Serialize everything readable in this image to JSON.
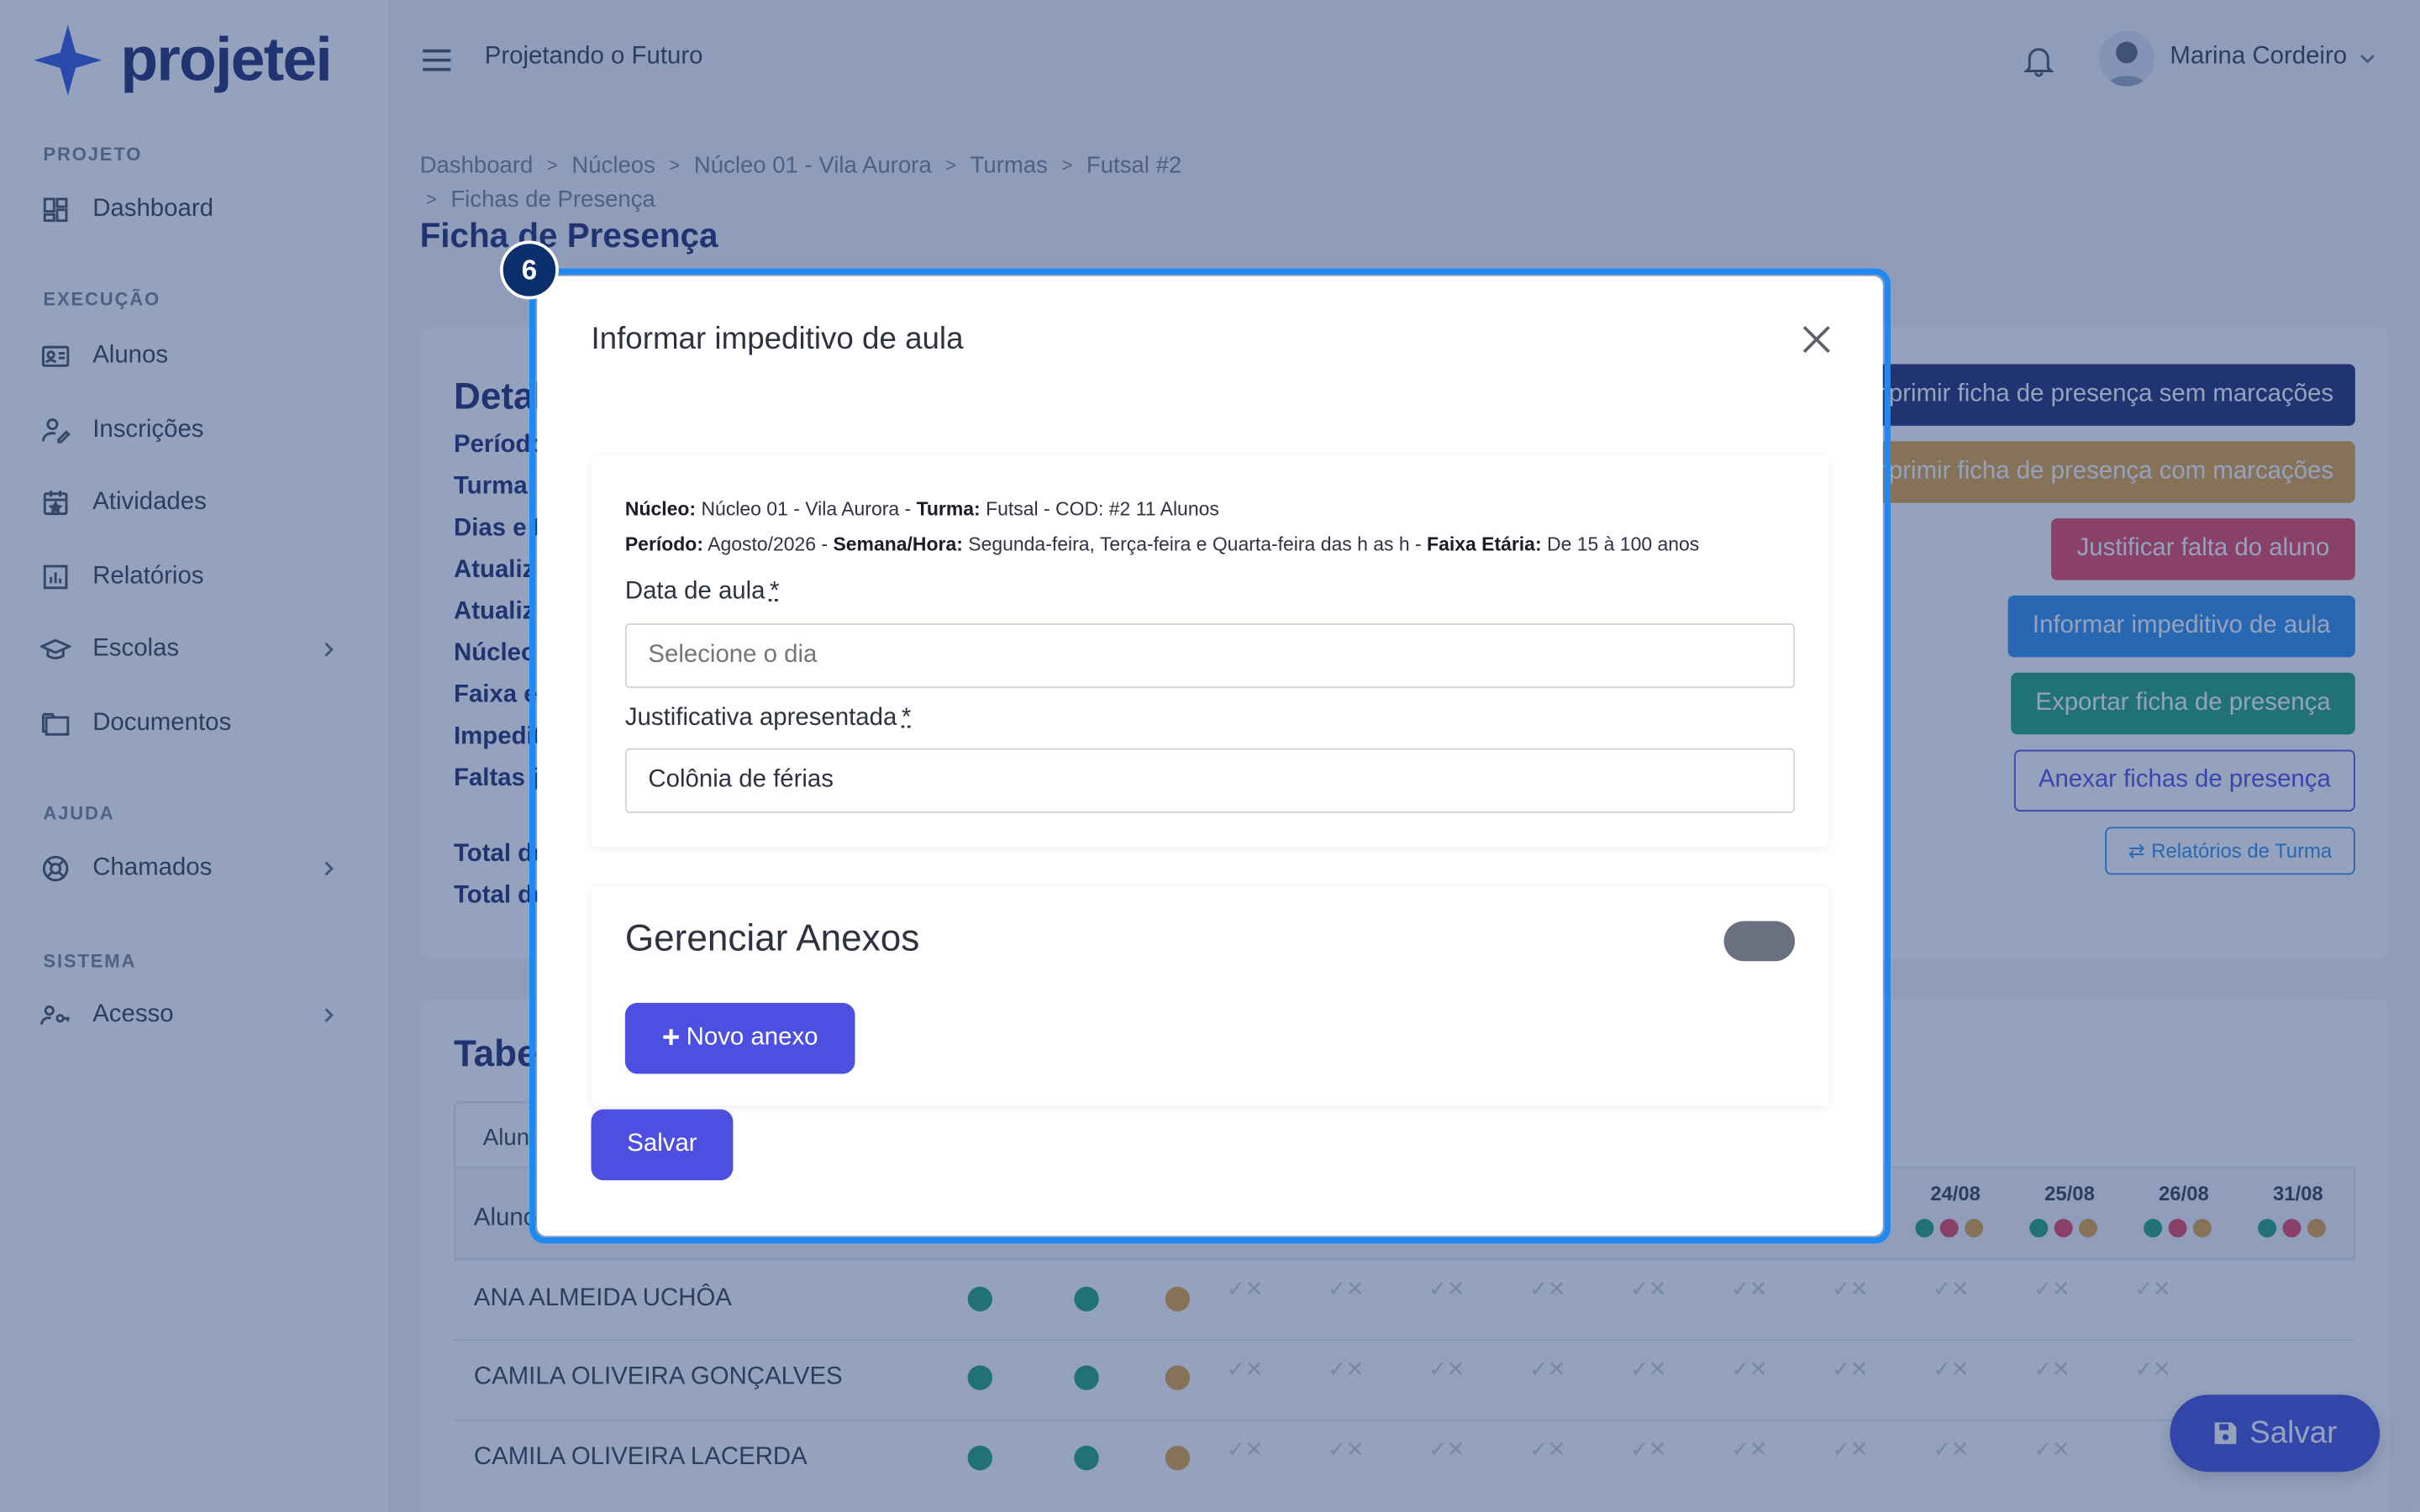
{
  "brand": {
    "name": "projetei"
  },
  "header": {
    "title": "Projetando o Futuro",
    "user_name": "Marina Cordeiro"
  },
  "sidebar": {
    "sections": [
      {
        "label": "PROJETO",
        "items": [
          {
            "label": "Dashboard",
            "icon": "dashboard-icon"
          }
        ]
      },
      {
        "label": "EXECUÇÃO",
        "items": [
          {
            "label": "Alunos",
            "icon": "id-card-icon"
          },
          {
            "label": "Inscrições",
            "icon": "user-edit-icon"
          },
          {
            "label": "Atividades",
            "icon": "calendar-icon"
          },
          {
            "label": "Relatórios",
            "icon": "bar-chart-icon"
          },
          {
            "label": "Escolas",
            "icon": "graduation-cap-icon",
            "has_children": true
          },
          {
            "label": "Documentos",
            "icon": "folder-icon"
          }
        ]
      },
      {
        "label": "AJUDA",
        "items": [
          {
            "label": "Chamados",
            "icon": "lifebuoy-icon",
            "has_children": true
          }
        ]
      },
      {
        "label": "SISTEMA",
        "items": [
          {
            "label": "Acesso",
            "icon": "users-key-icon",
            "has_children": true
          }
        ]
      }
    ]
  },
  "breadcrumb": {
    "items": [
      "Dashboard",
      "Núcleos",
      "Núcleo 01 - Vila Aurora",
      "Turmas",
      "Futsal #2",
      "Fichas de Presença"
    ]
  },
  "page": {
    "title": "Ficha de Presença"
  },
  "details": {
    "title_partial": "Detal",
    "labels": [
      "Período",
      "Turma",
      "Dias e H",
      "Atualiz",
      "Atualiz",
      "Núcleo",
      "Faixa e",
      "Impedit",
      "Faltas j"
    ],
    "totals": [
      "Total de",
      "Total de"
    ]
  },
  "actions": {
    "print_blank": "Imprimir ficha de presença sem marcações",
    "print_marked": "Imprimir ficha de presença com marcações",
    "justify_absence": "Justificar falta do aluno",
    "report_impediment": "Informar impeditivo de aula",
    "export": "Exportar ficha de presença",
    "attach": "Anexar fichas de presença",
    "class_reports": "Relatórios de Turma"
  },
  "table": {
    "title_partial": "Tabe",
    "tab_partial": "Alun",
    "student_header_partial": "Aluno",
    "dates": [
      "24/08",
      "25/08",
      "26/08",
      "31/08"
    ],
    "students": [
      "ANA ALMEIDA UCHÔA",
      "CAMILA OLIVEIRA GONÇALVES",
      "CAMILA OLIVEIRA LACERDA"
    ]
  },
  "fab": {
    "label": "Salvar"
  },
  "modal": {
    "step": "6",
    "title": "Informar impeditivo de aula",
    "info": {
      "nucleo_label": "Núcleo:",
      "nucleo_value": "Núcleo 01 - Vila Aurora - ",
      "turma_label": "Turma:",
      "turma_value": "Futsal - COD: #2 11 Alunos",
      "periodo_label": "Período:",
      "periodo_value": "Agosto/2026 - ",
      "semana_label": "Semana/Hora:",
      "semana_value": "Segunda-feira, Terça-feira e Quarta-feira das h as h - ",
      "faixa_label": "Faixa Etária:",
      "faixa_value": "De 15 à 100 anos"
    },
    "date_label": "Data de aula",
    "required_mark": "*",
    "date_placeholder": "Selecione o dia",
    "justification_label": "Justificativa apresentada",
    "justification_value": "Colônia de férias",
    "annex_title": "Gerenciar Anexos",
    "new_annex": "Novo anexo",
    "save": "Salvar"
  },
  "colors": {
    "primary": "#4d4fe0",
    "navy": "#1d2c6b",
    "highlight": "#1e88f5",
    "success": "#1fa37a",
    "danger": "#e8455a",
    "warning": "#e3a33c",
    "info": "#2f8fe8"
  }
}
